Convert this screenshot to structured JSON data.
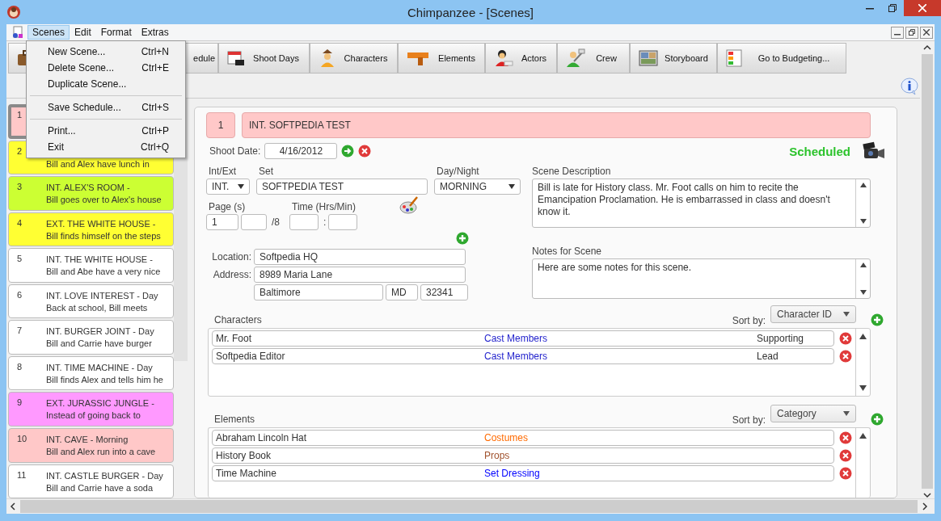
{
  "window": {
    "title": "Chimpanzee - [Scenes]"
  },
  "menu_bar": [
    {
      "label": "Scenes",
      "selected": true
    },
    {
      "label": "Edit",
      "selected": false
    },
    {
      "label": "Format",
      "selected": false
    },
    {
      "label": "Extras",
      "selected": false
    }
  ],
  "open_menu": [
    {
      "kind": "item",
      "label": "New Scene...",
      "shortcut": "Ctrl+N"
    },
    {
      "kind": "item",
      "label": "Delete Scene...",
      "shortcut": "Ctrl+E"
    },
    {
      "kind": "item",
      "label": "Duplicate Scene..."
    },
    {
      "kind": "separator"
    },
    {
      "kind": "item",
      "label": "Save Schedule...",
      "shortcut": "Ctrl+S"
    },
    {
      "kind": "separator"
    },
    {
      "kind": "item",
      "label": "Print...",
      "shortcut": "Ctrl+P"
    },
    {
      "kind": "item",
      "label": "Exit",
      "shortcut": "Ctrl+Q"
    }
  ],
  "toolbar": [
    {
      "label": "edule"
    },
    {
      "label": "Shoot Days"
    },
    {
      "label": "Characters"
    },
    {
      "label": "Elements"
    },
    {
      "label": "Actors"
    },
    {
      "label": "Crew"
    },
    {
      "label": "Storyboard"
    },
    {
      "label": "Go to Budgeting..."
    }
  ],
  "scenes": [
    {
      "number": "1",
      "color": "#ffc8c8",
      "selected": true
    },
    {
      "number": "2",
      "summary": "Bill and Alex have lunch in",
      "color": "#ffff33",
      "selected": false
    },
    {
      "number": "3",
      "heading": "INT. ALEX'S ROOM -",
      "summary": "Bill goes over to Alex's house",
      "color": "#ccff33",
      "selected": false
    },
    {
      "number": "4",
      "heading": "EXT. THE WHITE HOUSE -",
      "summary": "Bill finds himself on the steps",
      "color": "#ffff33",
      "selected": false
    },
    {
      "number": "5",
      "heading": "INT. THE WHITE HOUSE -",
      "summary": "Bill and Abe have a very nice",
      "color": "#ffffff",
      "selected": false
    },
    {
      "number": "6",
      "heading": "INT. LOVE INTEREST - Day",
      "summary": "Back at school, Bill meets",
      "color": "#ffffff",
      "selected": false
    },
    {
      "number": "7",
      "heading": "INT. BURGER JOINT - Day",
      "summary": "Bill and Carrie have burger",
      "color": "#ffffff",
      "selected": false
    },
    {
      "number": "8",
      "heading": "INT. TIME MACHINE - Day",
      "summary": "Bill finds Alex and tells him he",
      "color": "#ffffff",
      "selected": false
    },
    {
      "number": "9",
      "heading": "EXT. JURASSIC JUNGLE -",
      "summary": "Instead of going back to",
      "color": "#ff99ff",
      "selected": false
    },
    {
      "number": "10",
      "heading": "INT. CAVE - Morning",
      "summary": "Bill and Alex run into a cave",
      "color": "#ffc8c8",
      "selected": false
    },
    {
      "number": "11",
      "heading": "INT. CASTLE BURGER - Day",
      "summary": "Bill and Carrie have a soda",
      "color": "#ffffff",
      "selected": false
    }
  ],
  "scene": {
    "number": "1",
    "title": "INT. SOFTPEDIA TEST",
    "shoot_date_label": "Shoot Date:",
    "shoot_date": "4/16/2012",
    "status": "Scheduled",
    "int_ext_label": "Int/Ext",
    "int_ext": "INT.",
    "set_label": "Set",
    "set": "SOFTPEDIA TEST",
    "day_night_label": "Day/Night",
    "day_night": "MORNING",
    "pages_label": "Page (s)",
    "pages": "1",
    "pages_suffix": "/8",
    "time_label": "Time (Hrs/Min)",
    "time_separator": ":",
    "location_label": "Location:",
    "location": "Softpedia HQ",
    "address_label": "Address:",
    "address": "8989 Maria Lane",
    "city": "Baltimore",
    "state": "MD",
    "zip": "32341",
    "description_label": "Scene Description",
    "description": "Bill is late for History class. Mr. Foot calls on him to recite the Emancipation Proclamation. He is embarrassed in class and doesn't know it.",
    "notes_label": "Notes for Scene",
    "notes": "Here are some notes for this scene."
  },
  "characters": {
    "label": "Characters",
    "sort_label": "Sort by:",
    "sort": "Character ID",
    "rows": [
      {
        "name": "Mr. Foot",
        "category": "Cast Members",
        "color": "#1f1fcc",
        "role": "Supporting"
      },
      {
        "name": "Softpedia Editor",
        "category": "Cast Members",
        "color": "#1f1fcc",
        "role": "Lead"
      }
    ]
  },
  "elements": {
    "label": "Elements",
    "sort_label": "Sort by:",
    "sort": "Category",
    "rows": [
      {
        "name": "Abraham Lincoln Hat",
        "category": "Costumes",
        "color": "#ff6a00"
      },
      {
        "name": "History Book",
        "category": "Props",
        "color": "#a0522d"
      },
      {
        "name": "Time Machine",
        "category": "Set Dressing",
        "color": "#0000ff"
      }
    ]
  }
}
